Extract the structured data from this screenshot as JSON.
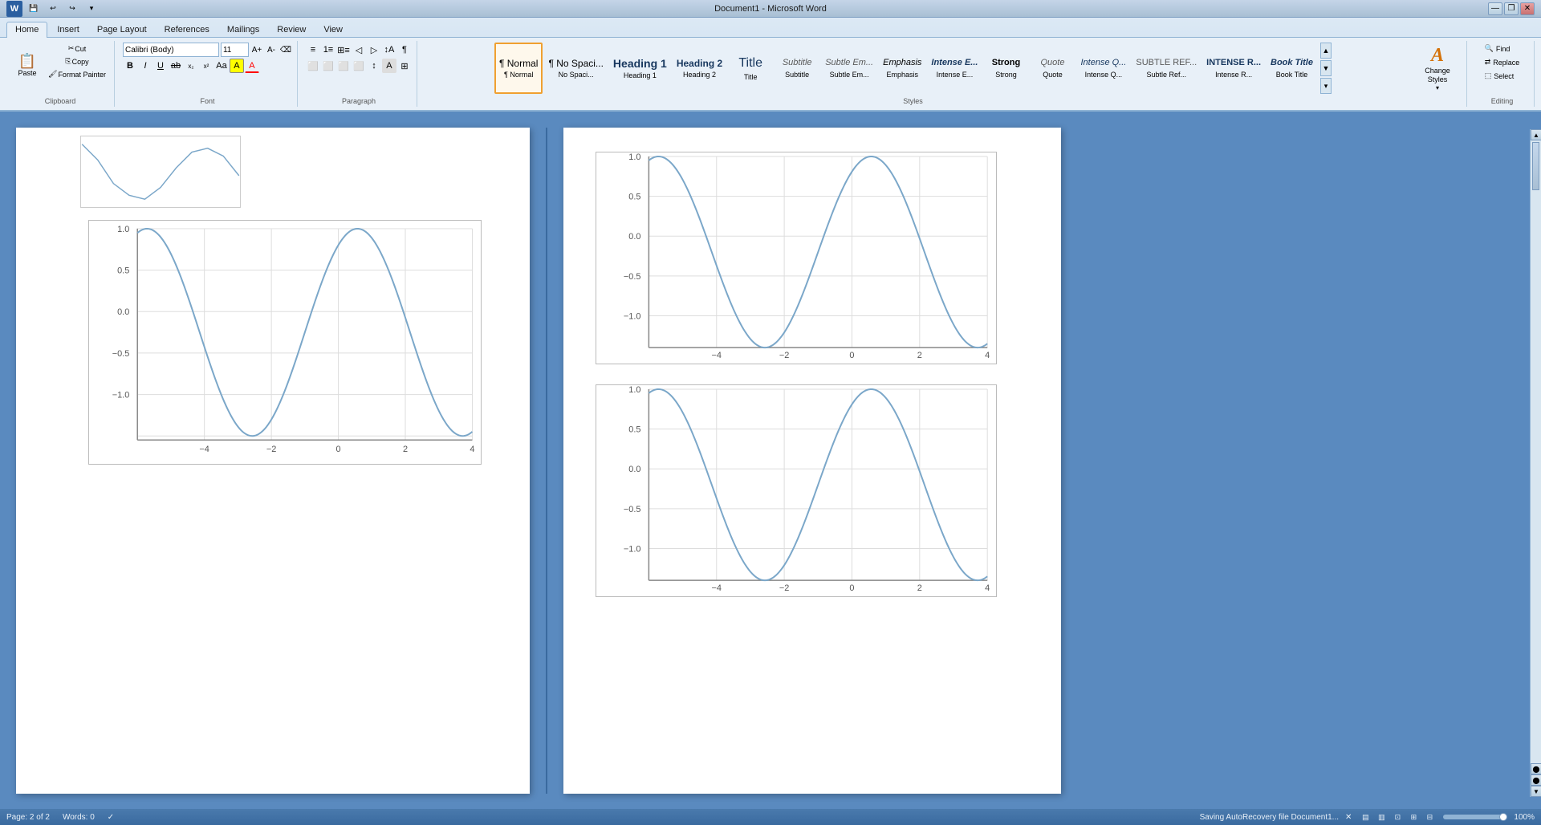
{
  "titlebar": {
    "title": "Document1 - Microsoft Word",
    "min_btn": "—",
    "restore_btn": "❐",
    "close_btn": "✕"
  },
  "ribbon": {
    "tabs": [
      "Home",
      "Insert",
      "Page Layout",
      "References",
      "Mailings",
      "Review",
      "View"
    ],
    "active_tab": "Home",
    "groups": {
      "clipboard": {
        "label": "Clipboard",
        "paste_label": "Paste",
        "cut_label": "Cut",
        "copy_label": "Copy",
        "format_painter_label": "Format Painter"
      },
      "font": {
        "label": "Font",
        "font_name": "Calibri (Body)",
        "font_size": "11",
        "bold": "B",
        "italic": "I",
        "underline": "U",
        "strikethrough": "ab",
        "sub": "x₂",
        "sup": "x²",
        "change_case": "Aa",
        "highlight": "A",
        "color": "A"
      },
      "paragraph": {
        "label": "Paragraph"
      },
      "styles": {
        "label": "Styles",
        "items": [
          {
            "name": "Normal",
            "preview": "¶ Normal",
            "label": "¶ Normal",
            "sub": "Normal",
            "active": true
          },
          {
            "name": "No Spacing",
            "preview": "¶ No Spaci...",
            "label": "¶ No Spaci...",
            "sub": "No Spaci..."
          },
          {
            "name": "Heading 1",
            "preview": "Heading 1",
            "label": "Heading 1",
            "sub": "Heading 1"
          },
          {
            "name": "Heading 2",
            "preview": "Heading 2",
            "label": "Heading 2",
            "sub": "Heading 2"
          },
          {
            "name": "Title",
            "preview": "Title",
            "label": "Title",
            "sub": "Title"
          },
          {
            "name": "Subtitle",
            "preview": "Subtitle",
            "label": "Subtitle",
            "sub": "Subtitle"
          },
          {
            "name": "Subtle Em",
            "preview": "Subtle Em...",
            "label": "Subtle Em...",
            "sub": "Subtle Em..."
          },
          {
            "name": "Emphasis",
            "preview": "Emphasis",
            "label": "Emphasis",
            "sub": "Emphasis"
          },
          {
            "name": "Intense E",
            "preview": "Intense E...",
            "label": "Intense E...",
            "sub": "Intense E..."
          },
          {
            "name": "Strong",
            "preview": "Strong",
            "label": "Strong",
            "sub": "Strong"
          },
          {
            "name": "Quote",
            "preview": "Quote",
            "label": "Quote",
            "sub": "Quote"
          },
          {
            "name": "Intense Q",
            "preview": "Intense Q...",
            "label": "Intense Q...",
            "sub": "Intense Q..."
          },
          {
            "name": "Subtle Ref",
            "preview": "Subtle Ref...",
            "label": "Subtle Ref...",
            "sub": "Subtle Ref..."
          },
          {
            "name": "Intense R",
            "preview": "Intense R...",
            "label": "Intense R...",
            "sub": "Intense R..."
          },
          {
            "name": "Book Title",
            "preview": "Book Title",
            "label": "Book Title",
            "sub": "Book Title"
          }
        ]
      },
      "change_styles": {
        "label": "Change\nStyles",
        "icon": "A"
      },
      "editing": {
        "label": "Editing",
        "find_label": "Find",
        "replace_label": "Replace",
        "select_label": "Select"
      }
    }
  },
  "statusbar": {
    "page_info": "Page: 2 of 2",
    "words_info": "Words: 0",
    "status_msg": "Saving AutoRecovery file Document1...",
    "zoom_level": "100%",
    "view_modes": [
      "▤",
      "▥",
      "⊡",
      "⊞",
      "⊟"
    ]
  },
  "charts": {
    "sine_curve_color": "#7ba7c9",
    "axis_color": "#888",
    "grid_color": "#e0e0e0",
    "x_ticks": [
      "-4",
      "-2",
      "0",
      "2",
      "4"
    ],
    "y_ticks_main": [
      "1.0",
      "0.5",
      "0.0",
      "-0.5",
      "-1.0"
    ],
    "y_ticks_right": [
      "1.0",
      "0.5",
      "0.0",
      "-0.5",
      "-1.0"
    ],
    "x_range": [
      -5,
      5
    ],
    "amplitude": 1
  }
}
